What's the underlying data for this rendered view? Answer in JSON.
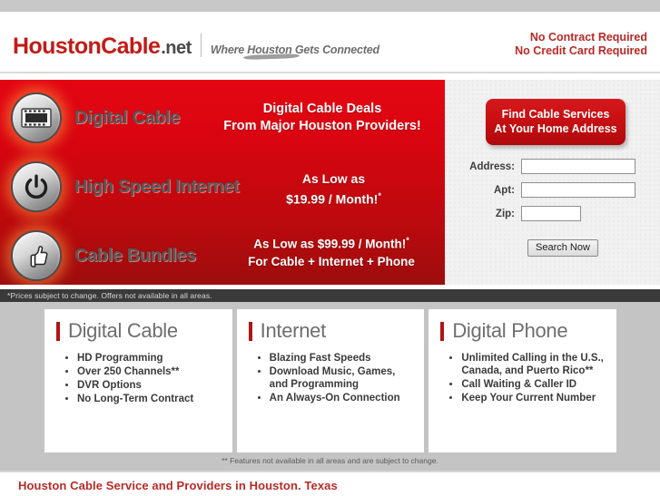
{
  "header": {
    "logo_main": "HoustonCable",
    "logo_tld": ".net",
    "tagline": "Where Houston Gets Connected",
    "promo_line1": "No Contract Required",
    "promo_line2": "No Credit Card Required"
  },
  "hero": {
    "services": [
      {
        "label": "Digital Cable",
        "icon": "film-strip-icon"
      },
      {
        "label": "High Speed Internet",
        "icon": "power-button-icon"
      },
      {
        "label": "Cable Bundles",
        "icon": "thumbs-up-icon"
      }
    ],
    "promo_cable_line1": "Digital Cable Deals",
    "promo_cable_line2": "From Major Houston Providers!",
    "promo_internet_line1": "As Low as",
    "promo_internet_line2": "$19.99 / Month!",
    "promo_bundle_line1": "As Low as $99.99 / Month!",
    "promo_bundle_line2": "For Cable + Internet + Phone",
    "asterisk": "*"
  },
  "search": {
    "cta_line1": "Find Cable Services",
    "cta_line2": "At Your Home Address",
    "address_label": "Address:",
    "address_value": "",
    "apt_label": "Apt:",
    "apt_value": "",
    "zip_label": "Zip:",
    "zip_value": "",
    "submit_label": "Search Now"
  },
  "disclaimer": "*Prices subject to change. Offers not available in all areas.",
  "features": {
    "columns": [
      {
        "title": "Digital Cable",
        "items": [
          "HD Programming",
          "Over 250 Channels**",
          "DVR Options",
          "No Long-Term Contract"
        ]
      },
      {
        "title": "Internet",
        "items": [
          "Blazing Fast Speeds",
          "Download Music, Games, and Programming",
          "An Always-On Connection"
        ]
      },
      {
        "title": "Digital Phone",
        "items": [
          "Unlimited Calling in the U.S., Canada, and Puerto Rico**",
          "Call Waiting & Caller ID",
          "Keep Your Current Number"
        ]
      }
    ],
    "note": "** Features not available in all areas and are subject to change."
  },
  "footer": {
    "heading": "Houston Cable Service and Providers in Houston. Texas"
  },
  "colors": {
    "brand_red": "#c21b17",
    "hero_red": "#d80510",
    "accent_bar": "#b01418",
    "dark_strip": "#3a3a3a",
    "features_bg": "#c4c4c4"
  }
}
